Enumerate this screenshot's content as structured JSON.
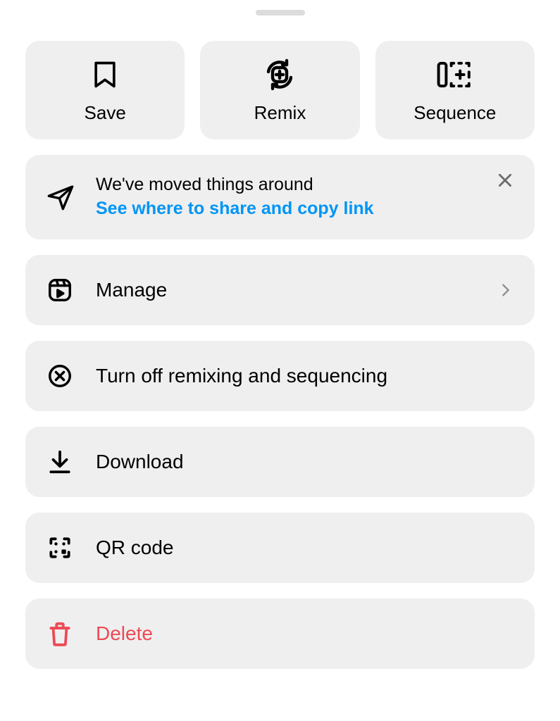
{
  "top": {
    "save": {
      "label": "Save"
    },
    "remix": {
      "label": "Remix"
    },
    "sequence": {
      "label": "Sequence"
    }
  },
  "banner": {
    "message": "We've moved things around",
    "link": "See where to share and copy link"
  },
  "rows": {
    "manage": {
      "label": "Manage"
    },
    "remixoff": {
      "label": "Turn off remixing and sequencing"
    },
    "download": {
      "label": "Download"
    },
    "qrcode": {
      "label": "QR code"
    },
    "delete": {
      "label": "Delete"
    }
  },
  "colors": {
    "link": "#0095f6",
    "destructive": "#ed4956"
  }
}
